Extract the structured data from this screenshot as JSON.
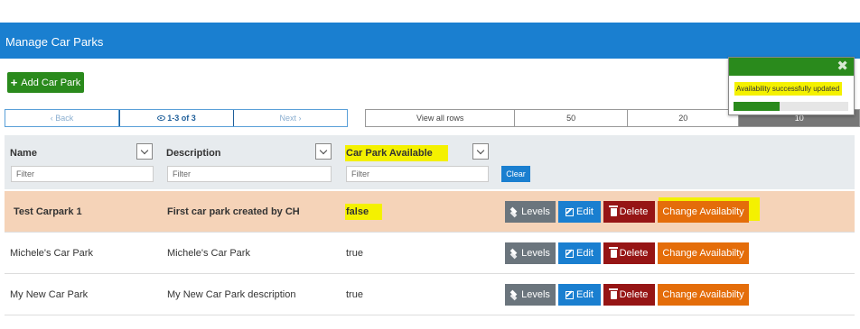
{
  "header": {
    "title": "Manage Car Parks"
  },
  "toolbar": {
    "add_label": "Add Car Park"
  },
  "pager": {
    "back_label": "Back",
    "current_label": "1-3 of 3",
    "next_label": "Next"
  },
  "rows_per_page": {
    "options": [
      "View all rows",
      "50",
      "20",
      "10"
    ],
    "selected": "10"
  },
  "columns": [
    {
      "title": "Name",
      "filter_placeholder": "Filter"
    },
    {
      "title": "Description",
      "filter_placeholder": "Filter"
    },
    {
      "title": "Car Park Available",
      "filter_placeholder": "Filter"
    }
  ],
  "clear_label": "Clear",
  "actions": {
    "levels": "Levels",
    "edit": "Edit",
    "delete": "Delete",
    "change": "Change Availabilty"
  },
  "rows": [
    {
      "name": "Test Carpark 1",
      "description": "First car park created by CH",
      "available": "false",
      "selected": true
    },
    {
      "name": "Michele's Car Park",
      "description": "Michele's Car Park",
      "available": "true",
      "selected": false
    },
    {
      "name": "My New Car Park",
      "description": "My New Car Park description",
      "available": "true",
      "selected": false
    }
  ],
  "toast": {
    "message": "Availability successfully updated",
    "progress_fraction": 0.4
  },
  "colors": {
    "header": "#1a7fd0",
    "success": "#2a8a1c",
    "danger": "#961515",
    "warning": "#e46d0a",
    "secondary": "#6b757d",
    "highlight": "#f4f100",
    "selected_row": "#f5d3b8"
  },
  "icons": {
    "add": "plus-icon",
    "back": "chevron-left-icon",
    "next": "chevron-right-icon",
    "pager": "eye-icon",
    "sort": "chevron-down-icon",
    "levels": "layers-icon",
    "edit": "edit-icon",
    "delete": "trash-icon",
    "toast_close": "close-icon"
  }
}
